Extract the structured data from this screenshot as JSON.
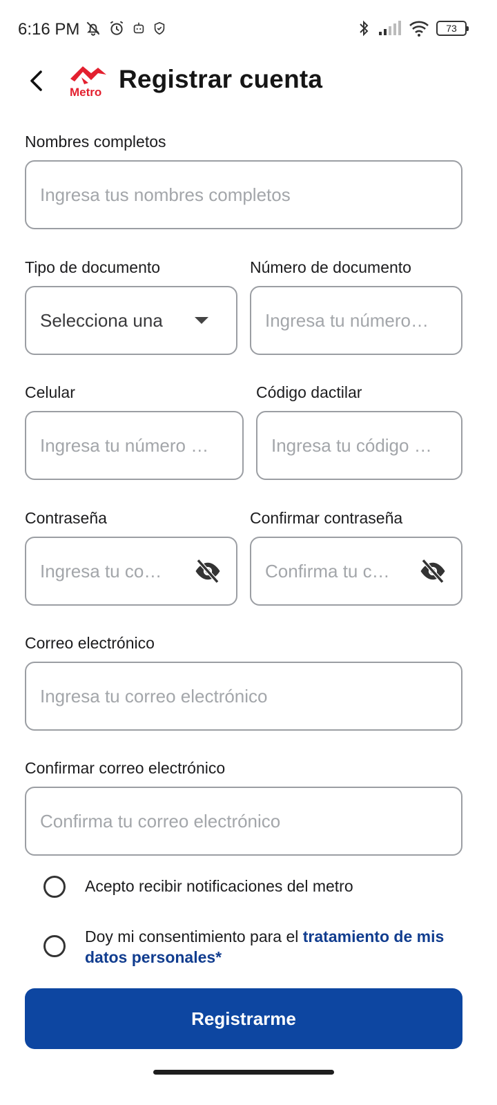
{
  "status_bar": {
    "time": "6:16 PM",
    "battery": "73",
    "left_icons": [
      "bell-off-icon",
      "alarm-icon",
      "robot-icon",
      "shield-icon"
    ],
    "right_icons": [
      "bluetooth-icon",
      "signal-icon",
      "wifi-icon",
      "battery-icon"
    ]
  },
  "header": {
    "title": "Registrar cuenta",
    "logo_text": "Metro",
    "brand_color": "#e3202f"
  },
  "form": {
    "full_name": {
      "label": "Nombres completos",
      "placeholder": "Ingresa tus nombres completos"
    },
    "doc_type": {
      "label": "Tipo de documento",
      "value": "Selecciona una"
    },
    "doc_number": {
      "label": "Número de documento",
      "placeholder": "Ingresa tu número…"
    },
    "phone": {
      "label": "Celular",
      "placeholder": "Ingresa tu número …"
    },
    "fingerprint_code": {
      "label": "Código dactilar",
      "placeholder": "Ingresa tu código …"
    },
    "password": {
      "label": "Contraseña",
      "placeholder": "Ingresa tu co…"
    },
    "confirm_password": {
      "label": "Confirmar contraseña",
      "placeholder": "Confirma tu c…"
    },
    "email": {
      "label": "Correo electrónico",
      "placeholder": "Ingresa tu correo electrónico"
    },
    "confirm_email": {
      "label": "Confirmar correo electrónico",
      "placeholder": "Confirma tu correo electrónico"
    }
  },
  "consents": {
    "notifications": "Acepto recibir notificaciones del metro",
    "data_prefix": "Doy mi consentimiento para el ",
    "data_link": "tratamiento de mis datos personales*"
  },
  "actions": {
    "submit_label": "Registrarme",
    "accent_color": "#0d46a1"
  }
}
